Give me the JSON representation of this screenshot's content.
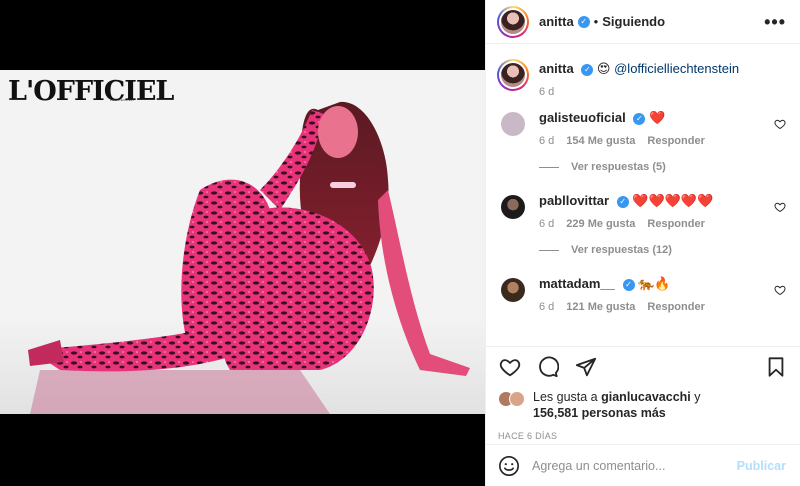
{
  "header": {
    "username": "anitta",
    "follow_status": "Siguiendo",
    "separator": "•",
    "more": "•••"
  },
  "media": {
    "magazine_logo": "L'OFFICIEL",
    "magazine_sub": "LIECHTENSTEIN"
  },
  "caption": {
    "username": "anitta",
    "emoji": "😍",
    "mention": "@lofficielliechtenstein",
    "time": "6 d"
  },
  "comments": [
    {
      "username": "galisteuoficial",
      "text": "❤️",
      "time": "6 d",
      "likes": "154 Me gusta",
      "reply": "Responder",
      "view_replies": "Ver respuestas (5)",
      "avatar_color": "#c9b8c6"
    },
    {
      "username": "pabllovittar",
      "text": "❤️❤️❤️❤️❤️",
      "time": "6 d",
      "likes": "229 Me gusta",
      "reply": "Responder",
      "view_replies": "Ver respuestas (12)",
      "avatar_color": "#3a3330"
    },
    {
      "username": "mattadam__",
      "text": "🐅🔥",
      "time": "6 d",
      "likes": "121 Me gusta",
      "reply": "Responder",
      "view_replies": "",
      "avatar_color": "#5a4a3a"
    }
  ],
  "likes": {
    "prefix": "Les gusta a",
    "user": "gianlucavacchi",
    "conj": "y",
    "others": "156,581 personas más"
  },
  "timestamp": "HACE 6 DÍAS",
  "add_comment": {
    "placeholder": "Agrega un comentario...",
    "post_label": "Publicar"
  },
  "icons": {
    "like": "heart-icon",
    "comment": "comment-icon",
    "share": "share-icon",
    "save": "bookmark-icon",
    "emoji": "smile-icon"
  },
  "colors": {
    "verified": "#3897f0",
    "post_button": "#b2dffc",
    "secondary_text": "#8e8e8e",
    "mention": "#00376b"
  }
}
